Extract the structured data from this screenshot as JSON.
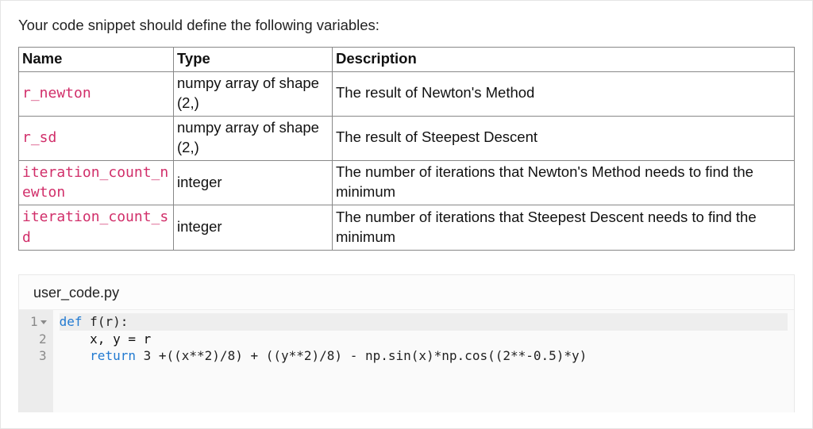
{
  "intro": "Your code snippet should define the following variables:",
  "table": {
    "headers": {
      "name": "Name",
      "type": "Type",
      "desc": "Description"
    },
    "rows": [
      {
        "name": "r_newton",
        "type": "numpy array of shape (2,)",
        "desc": "The result of Newton's Method"
      },
      {
        "name": "r_sd",
        "type": "numpy array of shape (2,)",
        "desc": "The result of Steepest Descent"
      },
      {
        "name": "iteration_count_newton",
        "type": "integer",
        "desc": "The number of iterations that Newton's Method needs to find the minimum"
      },
      {
        "name": "iteration_count_sd",
        "type": "integer",
        "desc": "The number of iterations that Steepest Descent needs to find the minimum"
      }
    ]
  },
  "code": {
    "filename": "user_code.py",
    "line_numbers": [
      "1",
      "2",
      "3"
    ],
    "lines": {
      "l1_kw1": "def",
      "l1_fn": " f(r):",
      "l2": "    x, y = r",
      "l3_a": "    ",
      "l3_kw": "return",
      "l3_b": " 3 +((x**2)/8) + ((y**2)/8) - np.sin(x)*np.cos((2**-0.5)*y)"
    }
  }
}
